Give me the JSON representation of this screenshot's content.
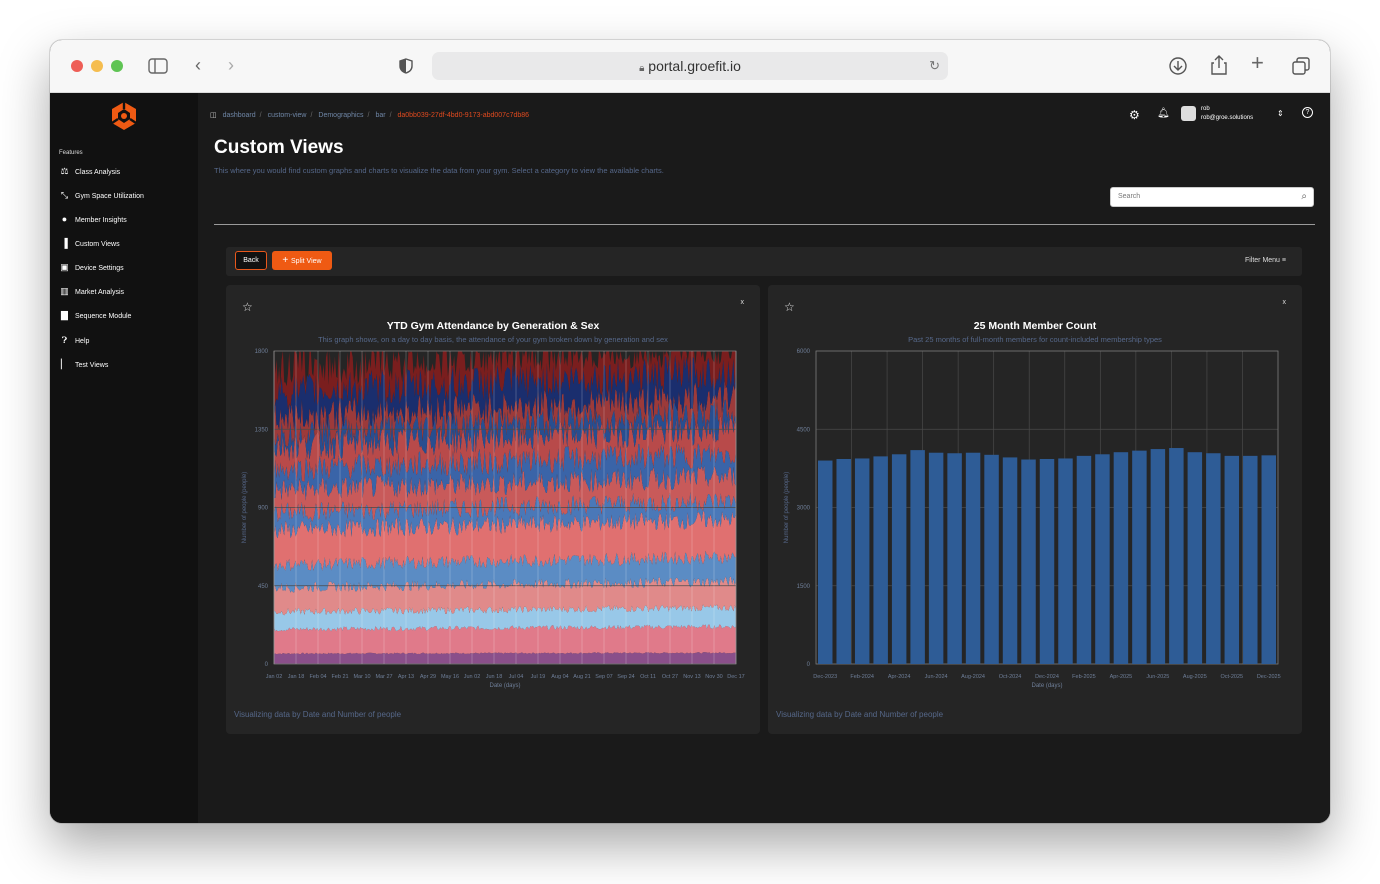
{
  "browser": {
    "url": "portal.groefit.io"
  },
  "sidebar": {
    "heading": "Features",
    "items": [
      {
        "label": "Class Analysis",
        "icon": "class-analysis-icon"
      },
      {
        "label": "Gym Space Utilization",
        "icon": "space-utilization-icon"
      },
      {
        "label": "Member Insights",
        "icon": "member-insights-icon"
      },
      {
        "label": "Custom Views",
        "icon": "bar-chart-icon"
      },
      {
        "label": "Device Settings",
        "icon": "camera-icon"
      },
      {
        "label": "Market Analysis",
        "icon": "map-icon"
      },
      {
        "label": "Sequence Module",
        "icon": "grid-icon"
      },
      {
        "label": "Help",
        "icon": "help-icon"
      },
      {
        "label": "Test Views",
        "icon": "test-tube-icon"
      }
    ]
  },
  "breadcrumb": [
    "dashboard",
    "custom-view",
    "Demographics",
    "bar",
    "da0bb039-27df-4bd0-9173-abd007c7db86"
  ],
  "header": {
    "user_name": "rob",
    "user_email": "rob@groe.solutions"
  },
  "page": {
    "title": "Custom Views",
    "subtitle": "This where you would find custom graphs and charts to visualize the data from your gym. Select a category to view the available charts.",
    "search_placeholder": "Search"
  },
  "toolbar": {
    "back_label": "Back",
    "split_label": "Split View",
    "filter_label": "Filter Menu"
  },
  "colors": {
    "accent": "#ef5a13",
    "bar_blue": "#2e5c96"
  },
  "chart_data": [
    {
      "type": "area",
      "title": "YTD Gym Attendance by Generation & Sex",
      "subtitle": "This graph shows, on a day to day basis, the attendance of your gym broken down by generation and sex",
      "xlabel": "Date (days)",
      "ylabel": "Number of people (people)",
      "ylim": [
        0,
        1800
      ],
      "yticks": [
        0,
        450,
        900,
        1350,
        1800
      ],
      "x_tick_labels": [
        "Jan 02",
        "Jan 18",
        "Feb 04",
        "Feb 21",
        "Mar 10",
        "Mar 27",
        "Apr 13",
        "Apr 29",
        "May 16",
        "Jun 02",
        "Jun 18",
        "Jul 04",
        "Jul 19",
        "Aug 04",
        "Aug 21",
        "Sep 07",
        "Sep 24",
        "Oct 11",
        "Oct 27",
        "Nov 13",
        "Nov 30",
        "Dec 17"
      ],
      "stack_colors": [
        "#8a4f8a",
        "#e07a8a",
        "#98c8e8",
        "#e08a8a",
        "#5b8cc4",
        "#e07070",
        "#4a78b8",
        "#c85a5a",
        "#3a64a8",
        "#b84a4a",
        "#284e90",
        "#9c3a3a",
        "#1a2e6e",
        "#7a1e1e"
      ],
      "stack_layers_approx_top": [
        60,
        200,
        300,
        440,
        570,
        770,
        870,
        1000,
        1120,
        1250,
        1330,
        1420,
        1560,
        1700
      ],
      "footer": "Visualizing data by Date and Number of people",
      "grid": true
    },
    {
      "type": "bar",
      "title": "25 Month Member Count",
      "subtitle": "Past 25 months of full-month members for count-included membership types",
      "xlabel": "Date (days)",
      "ylabel": "Number of people (people)",
      "ylim": [
        0,
        6000
      ],
      "yticks": [
        0,
        1500,
        3000,
        4500,
        6000
      ],
      "categories": [
        "Dec-2023",
        "Jan-2024",
        "Feb-2024",
        "Mar-2024",
        "Apr-2024",
        "May-2024",
        "Jun-2024",
        "Jul-2024",
        "Aug-2024",
        "Sep-2024",
        "Oct-2024",
        "Nov-2024",
        "Dec-2024",
        "Jan-2025",
        "Feb-2025",
        "Mar-2025",
        "Apr-2025",
        "May-2025",
        "Jun-2025",
        "Jul-2025",
        "Aug-2025",
        "Sep-2025",
        "Oct-2025",
        "Nov-2025",
        "Dec-2025"
      ],
      "tick_labels": [
        "Dec-2023",
        "Feb-2024",
        "Apr-2024",
        "Jun-2024",
        "Aug-2024",
        "Oct-2024",
        "Dec-2024",
        "Feb-2025",
        "Apr-2025",
        "Jun-2025",
        "Aug-2025",
        "Oct-2025",
        "Dec-2025"
      ],
      "values": [
        3900,
        3930,
        3940,
        3980,
        4020,
        4100,
        4050,
        4040,
        4050,
        4010,
        3960,
        3920,
        3930,
        3940,
        3990,
        4020,
        4060,
        4090,
        4120,
        4140,
        4060,
        4040,
        3990,
        3990,
        4000
      ],
      "footer": "Visualizing data by Date and Number of people",
      "grid": true
    }
  ]
}
